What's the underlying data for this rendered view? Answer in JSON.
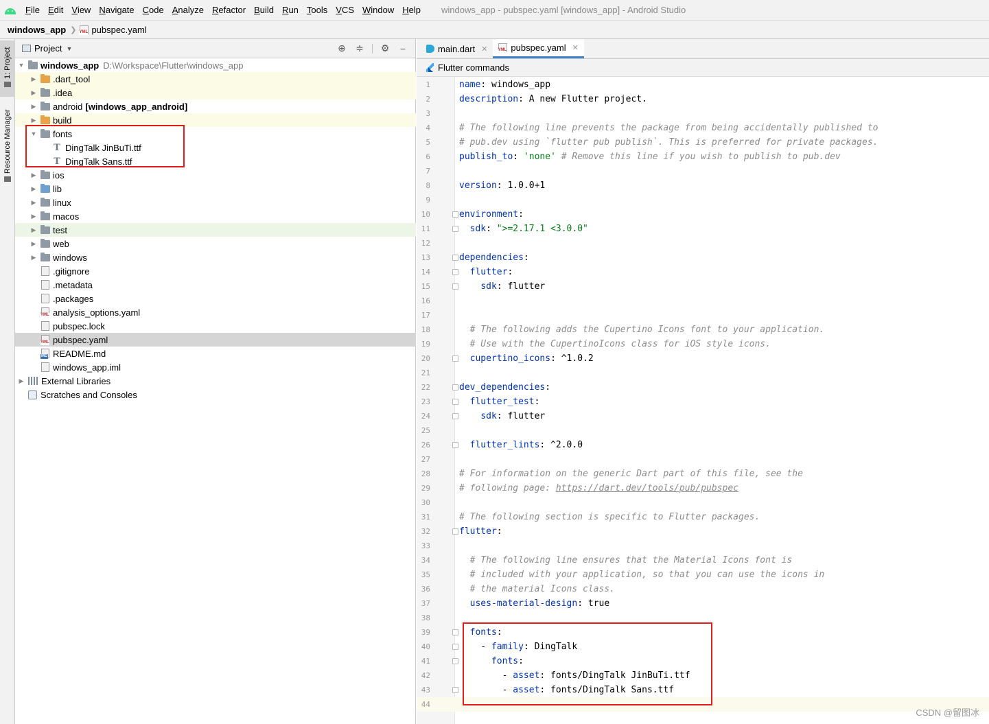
{
  "menu": {
    "items": [
      "File",
      "Edit",
      "View",
      "Navigate",
      "Code",
      "Analyze",
      "Refactor",
      "Build",
      "Run",
      "Tools",
      "VCS",
      "Window",
      "Help"
    ],
    "window_title": "windows_app - pubspec.yaml [windows_app] - Android Studio"
  },
  "breadcrumb": {
    "root": "windows_app",
    "file": "pubspec.yaml"
  },
  "toolstripe": {
    "project": "1: Project",
    "resource": "Resource Manager"
  },
  "project_panel": {
    "title": "Project",
    "tree": [
      {
        "label": "windows_app",
        "extra": "D:\\Workspace\\Flutter\\windows_app",
        "indent": 0,
        "arrow": "open",
        "icon": "folder-root",
        "bold": true,
        "bg": ""
      },
      {
        "label": ".dart_tool",
        "indent": 1,
        "arrow": "closed",
        "icon": "folder-orange",
        "bg": "yellow"
      },
      {
        "label": ".idea",
        "indent": 1,
        "arrow": "closed",
        "icon": "folder",
        "bg": "yellow"
      },
      {
        "label": "android",
        "extra_bold": "[windows_app_android]",
        "indent": 1,
        "arrow": "closed",
        "icon": "folder",
        "bg": ""
      },
      {
        "label": "build",
        "indent": 1,
        "arrow": "closed",
        "icon": "folder-orange",
        "bg": "yellow"
      },
      {
        "label": "fonts",
        "indent": 1,
        "arrow": "open",
        "icon": "folder",
        "bg": ""
      },
      {
        "label": "DingTalk JinBuTi.ttf",
        "indent": 2,
        "arrow": "none",
        "icon": "font",
        "bg": ""
      },
      {
        "label": "DingTalk Sans.ttf",
        "indent": 2,
        "arrow": "none",
        "icon": "font",
        "bg": ""
      },
      {
        "label": "ios",
        "indent": 1,
        "arrow": "closed",
        "icon": "folder",
        "bg": ""
      },
      {
        "label": "lib",
        "indent": 1,
        "arrow": "closed",
        "icon": "folder-blue",
        "bg": ""
      },
      {
        "label": "linux",
        "indent": 1,
        "arrow": "closed",
        "icon": "folder",
        "bg": ""
      },
      {
        "label": "macos",
        "indent": 1,
        "arrow": "closed",
        "icon": "folder",
        "bg": ""
      },
      {
        "label": "test",
        "indent": 1,
        "arrow": "closed",
        "icon": "folder",
        "bg": "green"
      },
      {
        "label": "web",
        "indent": 1,
        "arrow": "closed",
        "icon": "folder",
        "bg": ""
      },
      {
        "label": "windows",
        "indent": 1,
        "arrow": "closed",
        "icon": "folder",
        "bg": ""
      },
      {
        "label": ".gitignore",
        "indent": 1,
        "arrow": "none",
        "icon": "file",
        "bg": ""
      },
      {
        "label": ".metadata",
        "indent": 1,
        "arrow": "none",
        "icon": "file",
        "bg": ""
      },
      {
        "label": ".packages",
        "indent": 1,
        "arrow": "none",
        "icon": "file",
        "bg": ""
      },
      {
        "label": "analysis_options.yaml",
        "indent": 1,
        "arrow": "none",
        "icon": "yml",
        "bg": ""
      },
      {
        "label": "pubspec.lock",
        "indent": 1,
        "arrow": "none",
        "icon": "file",
        "bg": ""
      },
      {
        "label": "pubspec.yaml",
        "indent": 1,
        "arrow": "none",
        "icon": "yml",
        "bg": "selected"
      },
      {
        "label": "README.md",
        "indent": 1,
        "arrow": "none",
        "icon": "md",
        "bg": ""
      },
      {
        "label": "windows_app.iml",
        "indent": 1,
        "arrow": "none",
        "icon": "file",
        "bg": ""
      },
      {
        "label": "External Libraries",
        "indent": 0,
        "arrow": "closed",
        "icon": "lib",
        "bg": ""
      },
      {
        "label": "Scratches and Consoles",
        "indent": 0,
        "arrow": "none",
        "icon": "scratch",
        "bg": ""
      }
    ]
  },
  "editor": {
    "tabs": [
      {
        "label": "main.dart",
        "icon": "dart",
        "active": false
      },
      {
        "label": "pubspec.yaml",
        "icon": "yml",
        "active": true
      }
    ],
    "flutter_bar": "Flutter commands",
    "lines": [
      {
        "n": 1,
        "html": "<span class='k'>name</span>: windows_app"
      },
      {
        "n": 2,
        "html": "<span class='k'>description</span>: A new Flutter project."
      },
      {
        "n": 3,
        "html": ""
      },
      {
        "n": 4,
        "html": "<span class='c'># The following line prevents the package from being accidentally published to</span>"
      },
      {
        "n": 5,
        "html": "<span class='c'># pub.dev using `flutter pub publish`. This is preferred for private packages.</span>"
      },
      {
        "n": 6,
        "html": "<span class='k'>publish_to</span>: <span class='s'>'none'</span> <span class='c'># Remove this line if you wish to publish to pub.dev</span>"
      },
      {
        "n": 7,
        "html": ""
      },
      {
        "n": 8,
        "html": "<span class='k'>version</span>: 1.0.0+1"
      },
      {
        "n": 9,
        "html": ""
      },
      {
        "n": 10,
        "html": "<span class='k'>environment</span>:",
        "fold": true
      },
      {
        "n": 11,
        "html": "  <span class='k'>sdk</span>: <span class='s'>\">=2.17.1 &lt;3.0.0\"</span>",
        "fold": true
      },
      {
        "n": 12,
        "html": ""
      },
      {
        "n": 13,
        "html": "<span class='k'>dependencies</span>:",
        "fold": true
      },
      {
        "n": 14,
        "html": "  <span class='k'>flutter</span>:",
        "fold": true
      },
      {
        "n": 15,
        "html": "    <span class='k'>sdk</span>: flutter",
        "fold": true
      },
      {
        "n": 16,
        "html": ""
      },
      {
        "n": 17,
        "html": ""
      },
      {
        "n": 18,
        "html": "  <span class='c'># The following adds the Cupertino Icons font to your application.</span>"
      },
      {
        "n": 19,
        "html": "  <span class='c'># Use with the CupertinoIcons class for iOS style icons.</span>"
      },
      {
        "n": 20,
        "html": "  <span class='k'>cupertino_icons</span>: ^1.0.2",
        "fold": true
      },
      {
        "n": 21,
        "html": ""
      },
      {
        "n": 22,
        "html": "<span class='k'>dev_dependencies</span>:",
        "fold": true
      },
      {
        "n": 23,
        "html": "  <span class='k'>flutter_test</span>:",
        "fold": true
      },
      {
        "n": 24,
        "html": "    <span class='k'>sdk</span>: flutter",
        "fold": true
      },
      {
        "n": 25,
        "html": ""
      },
      {
        "n": 26,
        "html": "  <span class='k'>flutter_lints</span>: ^2.0.0",
        "fold": true
      },
      {
        "n": 27,
        "html": ""
      },
      {
        "n": 28,
        "html": "<span class='c'># For information on the generic Dart part of this file, see the</span>"
      },
      {
        "n": 29,
        "html": "<span class='c'># following page: <span class='u'>https://dart.dev/tools/pub/pubspec</span></span>"
      },
      {
        "n": 30,
        "html": ""
      },
      {
        "n": 31,
        "html": "<span class='c'># The following section is specific to Flutter packages.</span>"
      },
      {
        "n": 32,
        "html": "<span class='k'>flutter</span>:",
        "fold": true
      },
      {
        "n": 33,
        "html": ""
      },
      {
        "n": 34,
        "html": "  <span class='c'># The following line ensures that the Material Icons font is</span>"
      },
      {
        "n": 35,
        "html": "  <span class='c'># included with your application, so that you can use the icons in</span>"
      },
      {
        "n": 36,
        "html": "  <span class='c'># the material Icons class.</span>"
      },
      {
        "n": 37,
        "html": "  <span class='k'>uses-material-design</span>: true"
      },
      {
        "n": 38,
        "html": ""
      },
      {
        "n": 39,
        "html": "  <span class='k'>fonts</span>:",
        "fold": true
      },
      {
        "n": 40,
        "html": "    - <span class='k'>family</span>: DingTalk",
        "fold": true
      },
      {
        "n": 41,
        "html": "      <span class='k'>fonts</span>:",
        "fold": true
      },
      {
        "n": 42,
        "html": "        - <span class='k'>asset</span>: fonts/DingTalk JinBuTi.ttf"
      },
      {
        "n": 43,
        "html": "        - <span class='k'>asset</span>: fonts/DingTalk Sans.ttf",
        "fold": true
      },
      {
        "n": 44,
        "html": "",
        "current": true
      }
    ]
  },
  "watermark": "CSDN @留图冰"
}
